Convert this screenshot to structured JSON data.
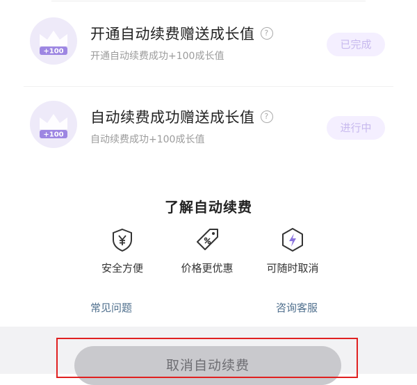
{
  "tasks": [
    {
      "title": "开通自动续费赠送成长值",
      "subtitle": "开通自动续费成功+100成长值",
      "status": "已完成",
      "badge_text": "+100",
      "help_symbol": "?"
    },
    {
      "title": "自动续费成功赠送成长值",
      "subtitle": "自动续费成功+100成长值",
      "status": "进行中",
      "badge_text": "+100",
      "help_symbol": "?"
    }
  ],
  "about": {
    "title": "了解自动续费",
    "features": [
      {
        "label": "安全方便",
        "icon": "shield-yen-icon"
      },
      {
        "label": "价格更优惠",
        "icon": "price-tag-icon"
      },
      {
        "label": "可随时取消",
        "icon": "lightning-hexagon-icon"
      }
    ],
    "links": {
      "faq": "常见问题",
      "service": "咨询客服"
    }
  },
  "footer": {
    "cancel_label": "取消自动续费"
  },
  "colors": {
    "accent_purple": "#9d86e2",
    "status_text": "#c7b9ee",
    "link": "#4f6f8d",
    "highlight_border": "#e02020",
    "cancel_button_bg": "#c9c9cd"
  }
}
